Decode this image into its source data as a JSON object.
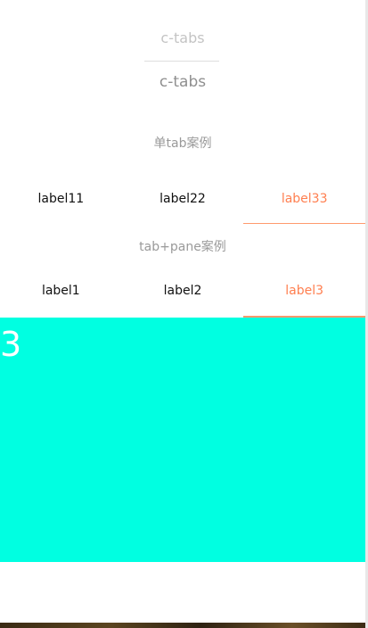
{
  "header": {
    "top_title": "c-tabs",
    "main_title": "c-tabs"
  },
  "section_single": {
    "heading": "单tab案例",
    "tabs": [
      {
        "label": "label11",
        "active": false
      },
      {
        "label": "label22",
        "active": false
      },
      {
        "label": "label33",
        "active": true
      }
    ]
  },
  "section_pane": {
    "heading": "tab+pane案例",
    "tabs": [
      {
        "label": "label1",
        "active": false
      },
      {
        "label": "label2",
        "active": false
      },
      {
        "label": "label3",
        "active": true
      }
    ],
    "pane_content": "3"
  },
  "colors": {
    "active_tab": "#ff7f50",
    "pane_background": "#00ffe1"
  }
}
